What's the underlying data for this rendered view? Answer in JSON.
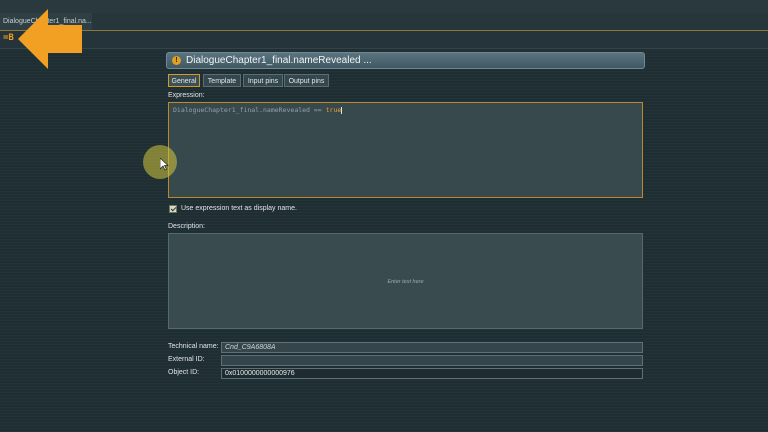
{
  "window": {
    "doc_tab_label": "DialogueChapter1_final.na..."
  },
  "toolbar": {
    "mini_label": "=B"
  },
  "colors": {
    "accent": "#f0a020",
    "panel": "#38494e",
    "background": "#1f2e33"
  },
  "panel": {
    "title": "DialogueChapter1_final.nameRevealed  ...",
    "title_icon": "condition-icon",
    "tabs": [
      {
        "label": "General",
        "active": true
      },
      {
        "label": "Template"
      },
      {
        "label": "Input pins"
      },
      {
        "label": "Output pins"
      }
    ],
    "expression_label": "Expression:",
    "expression_ref": "DialogueChapter1_final.nameRevealed",
    "expression_op": " == ",
    "expression_value": "true",
    "use_expression_label": "Use expression text as display name.",
    "use_expression_checked": true,
    "description_label": "Description:",
    "description_placeholder": "Enter text here",
    "technical_name_label": "Technical name:",
    "technical_name": "Cnd_C9A6808A",
    "external_id_label": "External ID:",
    "external_id": "",
    "object_id_label": "Object ID:",
    "object_id": "0x0100000000000976"
  }
}
